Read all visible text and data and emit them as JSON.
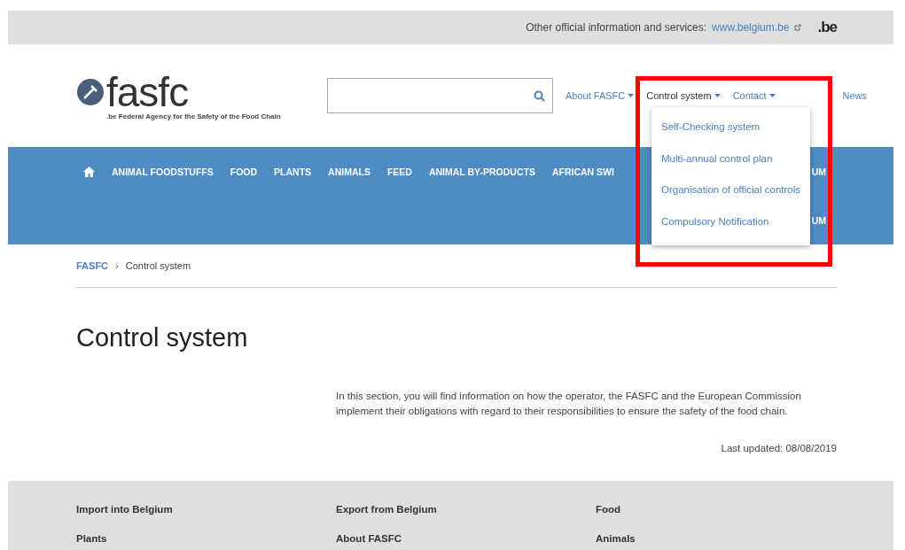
{
  "top_bar": {
    "text": "Other official information and services:",
    "link": "www.belgium.be",
    "badge": ".be"
  },
  "logo": {
    "name": "fasfc",
    "prefix": ".be",
    "tagline": "Federal Agency for the Safety of the Food Chain"
  },
  "top_menu": [
    {
      "label": "About FASFC",
      "selected": false,
      "dropdown": true
    },
    {
      "label": "Control system",
      "selected": true,
      "dropdown": true
    },
    {
      "label": "Contact",
      "selected": false,
      "dropdown": true
    },
    {
      "label": "News",
      "selected": false,
      "dropdown": false
    }
  ],
  "dropdown_menu": [
    "Self-Checking system",
    "Multi-annual control plan",
    "Organisation of official controls",
    "Compulsory Notification"
  ],
  "main_nav": {
    "row_1": [
      "ANIMAL FOODSTUFFS",
      "FOOD",
      "PLANTS",
      "ANIMALS",
      "FEED",
      "ANIMAL BY-PRODUCTS",
      "AFRICAN SWI"
    ],
    "row_1_end": "UM",
    "row_2_end": "UM"
  },
  "breadcrumb_separator": "›",
  "breadcrumb": [
    {
      "label": "FASFC",
      "link": true
    },
    {
      "label": "Control system",
      "link": false
    }
  ],
  "page_title": "Control system",
  "intro": "In this section, you will find information on how the operator, the FASFC and the European Commission implement their obligations with regard to their responsibilities to ensure the safety of the food chain.",
  "last_updated": "Last updated: 08/08/2019",
  "footer_links": [
    [
      "Import into Belgium",
      "Plants"
    ],
    [
      "Export from Belgium",
      "About FASFC"
    ],
    [
      "Food",
      "Animals"
    ]
  ],
  "highlight": {
    "on": true
  }
}
